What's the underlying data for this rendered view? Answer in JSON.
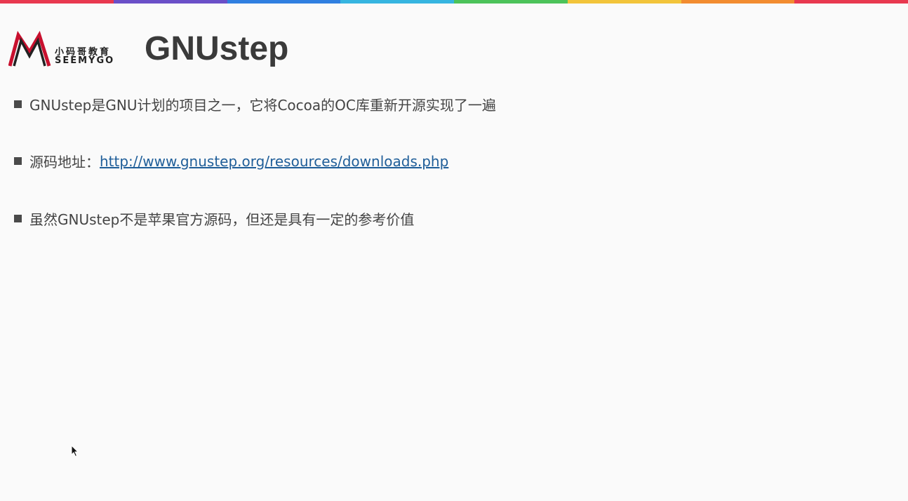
{
  "slide": {
    "title": "GNUstep",
    "logo": {
      "cn_text": "小码哥教育",
      "en_text": "SEEMYGO"
    },
    "color_bar": [
      "#e8384f",
      "#6a4fc8",
      "#2f7fe0",
      "#36b5e0",
      "#4cc35a",
      "#f2c43a",
      "#f28c30",
      "#e8384f"
    ],
    "bullets": [
      {
        "text": "GNUstep是GNU计划的项目之一，它将Cocoa的OC库重新开源实现了一遍"
      },
      {
        "label": "源码地址：",
        "link": "http://www.gnustep.org/resources/downloads.php"
      },
      {
        "text": "虽然GNUstep不是苹果官方源码，但还是具有一定的参考价值"
      }
    ]
  }
}
